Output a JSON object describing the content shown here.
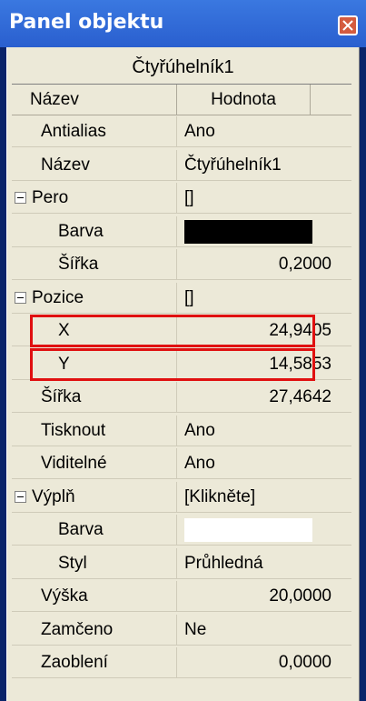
{
  "window": {
    "title": "Panel objektu"
  },
  "object_name": "Čtyřúhelník1",
  "columns": {
    "name": "Název",
    "value": "Hodnota"
  },
  "rows": [
    {
      "name": "Antialias",
      "value": "Ano"
    },
    {
      "name": "Název",
      "value": "Čtyřúhelník1"
    },
    {
      "name": "Pero",
      "value": "[]",
      "group": true
    },
    {
      "name": "Barva",
      "value": "",
      "swatch": "#000000"
    },
    {
      "name": "Šířka",
      "value": "0,2000"
    },
    {
      "name": "Pozice",
      "value": "[]",
      "group": true
    },
    {
      "name": "X",
      "value": "24,9405",
      "highlight": true
    },
    {
      "name": "Y",
      "value": "14,5853",
      "highlight": true
    },
    {
      "name": "Šířka",
      "value": "27,4642"
    },
    {
      "name": "Tisknout",
      "value": "Ano"
    },
    {
      "name": "Viditelné",
      "value": "Ano"
    },
    {
      "name": "Výplň",
      "value": "[Klikněte]",
      "group": true
    },
    {
      "name": "Barva",
      "value": "",
      "swatch": "#ffffff"
    },
    {
      "name": "Styl",
      "value": "Průhledná"
    },
    {
      "name": "Výška",
      "value": "20,0000"
    },
    {
      "name": "Zamčeno",
      "value": "Ne"
    },
    {
      "name": "Zaoblení",
      "value": "0,0000"
    }
  ],
  "colors": {
    "highlight": "#e01010",
    "title_bar": "#2a5fcf"
  }
}
